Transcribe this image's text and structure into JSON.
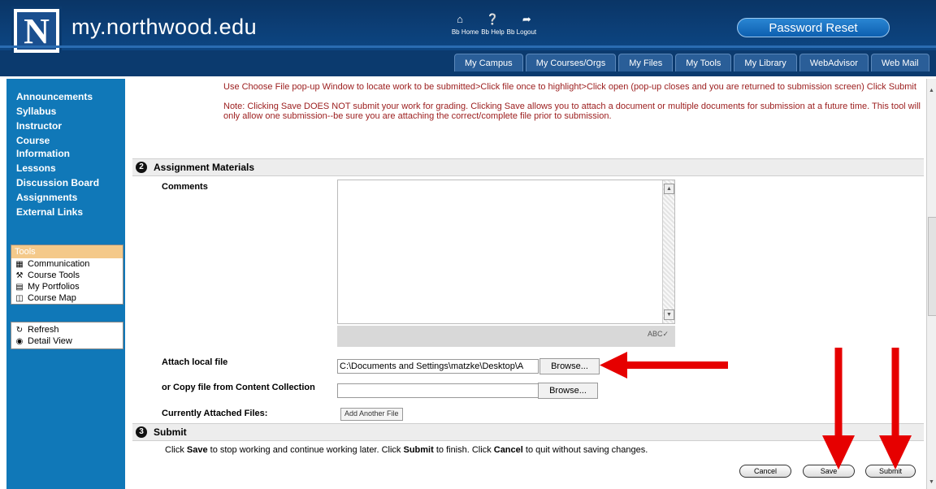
{
  "header": {
    "logo_letter": "N",
    "site_title": "my.northwood.edu",
    "top_links": [
      "Bb Home",
      "Bb Help",
      "Bb Logout"
    ],
    "top_icons": [
      "home-icon",
      "help-icon",
      "logout-icon"
    ],
    "password_reset": "Password Reset",
    "tabs": [
      "My Campus",
      "My Courses/Orgs",
      "My Files",
      "My Tools",
      "My Library",
      "WebAdvisor",
      "Web Mail"
    ]
  },
  "sidebar": {
    "nav": [
      "Announcements",
      "Syllabus",
      "Instructor",
      "Course Information",
      "Lessons",
      "Discussion Board",
      "Assignments",
      "External Links"
    ],
    "tools_heading": "Tools",
    "tools": [
      {
        "label": "Communication",
        "icon": "communication-icon"
      },
      {
        "label": "Course Tools",
        "icon": "course-tools-icon"
      },
      {
        "label": "My Portfolios",
        "icon": "portfolios-icon"
      },
      {
        "label": "Course Map",
        "icon": "course-map-icon"
      }
    ],
    "view_tools": [
      {
        "label": "Refresh",
        "icon": "refresh-icon"
      },
      {
        "label": "Detail View",
        "icon": "detail-view-icon"
      }
    ]
  },
  "main": {
    "instructions": [
      "Use Choose File pop-up Window to locate work to be submitted>Click file once to highlight>Click open (pop-up closes and you are returned to submission screen) Click Submit",
      "Note:  Clicking Save DOES NOT submit your work for grading.  Clicking Save allows you to attach a document or multiple documents for submission at a future time. This tool will only allow one submission--be sure you are attaching the correct/complete file prior to submission."
    ],
    "section2": {
      "number": "2",
      "title": "Assignment Materials"
    },
    "comments_label": "Comments",
    "comments_value": "",
    "attach_local_label": "Attach local file",
    "attach_local_value": "C:\\Documents and Settings\\matzke\\Desktop\\A",
    "browse_label": "Browse...",
    "copy_file_label": "or Copy file from Content Collection",
    "copy_file_value": "",
    "attached_files_label": "Currently Attached Files:",
    "add_file_label": "Add Another File",
    "section3": {
      "number": "3",
      "title": "Submit"
    },
    "submit_text": {
      "p1": "Click ",
      "save": "Save",
      "p2": " to stop working and continue working later. Click ",
      "submit": "Submit",
      "p3": " to finish. Click ",
      "cancel": "Cancel",
      "p4": " to quit without saving changes."
    },
    "buttons": {
      "cancel": "Cancel",
      "save": "Save",
      "submit": "Submit"
    },
    "annotation_color": "#e60000"
  }
}
